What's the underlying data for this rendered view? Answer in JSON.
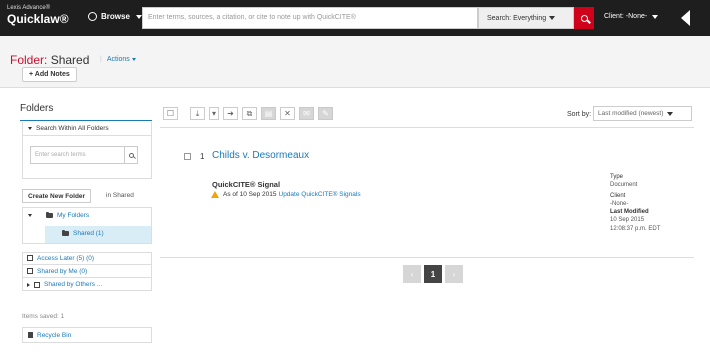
{
  "topbar": {
    "brand_line1": "Lexis Advance®",
    "brand_line2": "Quicklaw®",
    "browse_label": "Browse",
    "search_placeholder": "Enter terms, sources, a citation, or cite to note up with QuickCITE®",
    "search_scope": "Search: Everything",
    "client_label": "Client: -None-"
  },
  "header": {
    "title_prefix": "Folder:",
    "title_name": "Shared",
    "actions_label": "Actions",
    "add_notes_label": "+ Add Notes"
  },
  "sidebar": {
    "title": "Folders",
    "search_all_label": "Search Within All Folders",
    "search_placeholder": "Enter search terms",
    "create_folder_label": "Create New Folder",
    "in_shared_label": "in Shared",
    "my_folders_label": "My Folders",
    "shared_label": "Shared (1)",
    "quick_items": [
      {
        "label": "Access Later (5) (0)"
      },
      {
        "label": "Shared by Me (0)"
      },
      {
        "label": "Shared by Others ..."
      }
    ],
    "items_saved": "Items saved: 1",
    "recycle_label": "Recycle Bin"
  },
  "main": {
    "sort_label": "Sort by:",
    "sort_value": "Last modified (newest)",
    "document": {
      "number": "1",
      "title": "Childs v. Desormeaux",
      "signal_label": "QuickCITE® Signal",
      "signal_date": "As of 10 Sep 2015",
      "signal_link": "Update QuickCITE® Signals"
    },
    "meta": {
      "type_label": "Type",
      "type_value": "Document",
      "client_label": "Client",
      "client_value": "-None-",
      "modified_label": "Last Modified",
      "modified_date": "10 Sep 2015",
      "modified_time": "12:08:37 p.m. EDT"
    },
    "pagination": {
      "current_page": "1"
    }
  },
  "colors": {
    "accent_red": "#c8102e",
    "link_blue": "#1a7ab8",
    "topbar_bg": "#1e1e1e"
  }
}
